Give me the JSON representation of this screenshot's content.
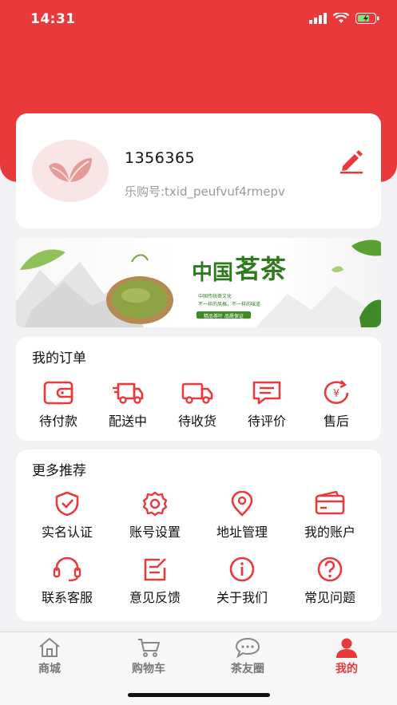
{
  "status_bar": {
    "time": "14:31"
  },
  "profile": {
    "username": "1356365",
    "user_id": "乐购号:txid_peufvuf4rmepv"
  },
  "banner": {
    "title_1": "中国",
    "title_2": "茗茶",
    "subtitle_1": "中国传统茶文化",
    "subtitle_2": "不一样的风格，不一样的味道",
    "tag": "精品茶叶 品质保证"
  },
  "orders": {
    "title": "我的订单",
    "items": [
      {
        "label": "待付款",
        "icon": "wallet-icon"
      },
      {
        "label": "配送中",
        "icon": "delivery-truck-icon"
      },
      {
        "label": "待收货",
        "icon": "truck-icon"
      },
      {
        "label": "待评价",
        "icon": "comment-icon"
      },
      {
        "label": "售后",
        "icon": "after-sale-icon"
      }
    ]
  },
  "more": {
    "title": "更多推荐",
    "items": [
      {
        "label": "实名认证",
        "icon": "shield-check-icon"
      },
      {
        "label": "账号设置",
        "icon": "gear-icon"
      },
      {
        "label": "地址管理",
        "icon": "location-pin-icon"
      },
      {
        "label": "我的账户",
        "icon": "card-icon"
      },
      {
        "label": "联系客服",
        "icon": "headset-icon"
      },
      {
        "label": "意见反馈",
        "icon": "edit-note-icon"
      },
      {
        "label": "关于我们",
        "icon": "info-icon"
      },
      {
        "label": "常见问题",
        "icon": "question-icon"
      }
    ]
  },
  "tabbar": {
    "items": [
      {
        "label": "商城",
        "icon": "shop-icon"
      },
      {
        "label": "购物车",
        "icon": "cart-icon"
      },
      {
        "label": "茶友圈",
        "icon": "chat-bubble-icon"
      },
      {
        "label": "我的",
        "icon": "person-icon"
      }
    ],
    "active_index": 3
  },
  "colors": {
    "accent": "#e9393b",
    "banner_green": "#2f7a1f"
  }
}
